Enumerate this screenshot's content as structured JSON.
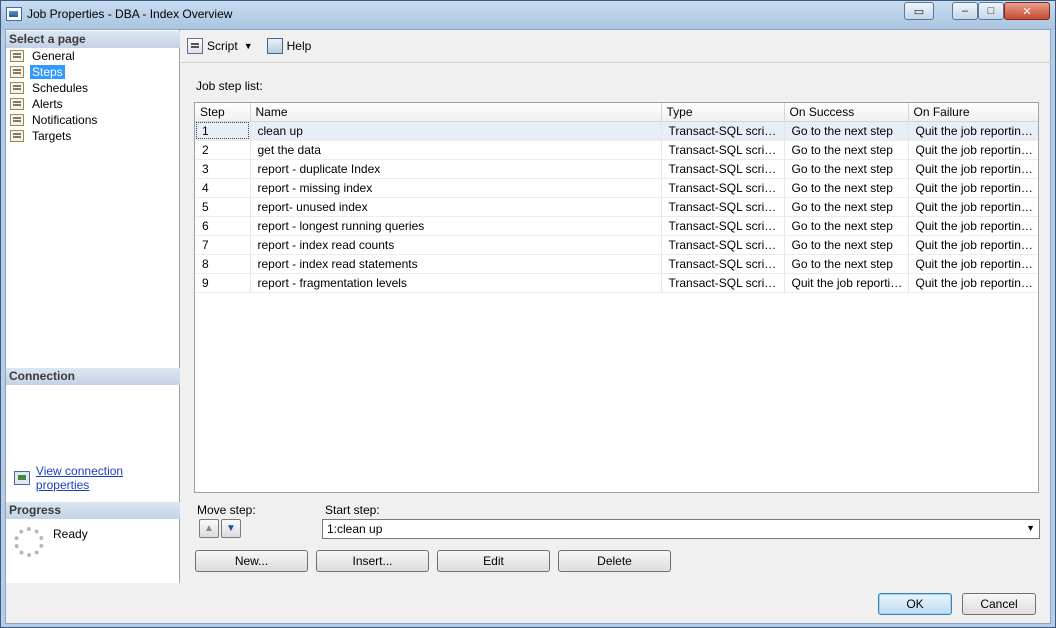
{
  "window": {
    "title": "Job Properties - DBA - Index Overview",
    "controls": {
      "minimize": "–",
      "maximize": "□",
      "close": "✕"
    }
  },
  "left_pane": {
    "select_page_header": "Select a page",
    "pages": [
      {
        "label": "General",
        "icon": "page-icon",
        "selected": false
      },
      {
        "label": "Steps",
        "icon": "page-icon",
        "selected": true
      },
      {
        "label": "Schedules",
        "icon": "page-icon",
        "selected": false
      },
      {
        "label": "Alerts",
        "icon": "page-icon",
        "selected": false
      },
      {
        "label": "Notifications",
        "icon": "page-icon",
        "selected": false
      },
      {
        "label": "Targets",
        "icon": "page-icon",
        "selected": false
      }
    ],
    "connection_header": "Connection",
    "view_connection_link": "View connection properties",
    "progress_header": "Progress",
    "progress_status": "Ready"
  },
  "toolbar": {
    "script_label": "Script",
    "help_label": "Help"
  },
  "main": {
    "job_step_list_label": "Job step list:",
    "columns": [
      "Step",
      "Name",
      "Type",
      "On Success",
      "On Failure"
    ],
    "rows": [
      [
        "1",
        "clean up",
        "Transact-SQL script (...",
        "Go to the next step",
        "Quit the job reporting f..."
      ],
      [
        "2",
        "get the data",
        "Transact-SQL script (...",
        "Go to the next step",
        "Quit the job reporting f..."
      ],
      [
        "3",
        "report - duplicate Index",
        "Transact-SQL script (...",
        "Go to the next step",
        "Quit the job reporting f..."
      ],
      [
        "4",
        "report - missing index",
        "Transact-SQL script (...",
        "Go to the next step",
        "Quit the job reporting f..."
      ],
      [
        "5",
        "report- unused index",
        "Transact-SQL script (...",
        "Go to the next step",
        "Quit the job reporting f..."
      ],
      [
        "6",
        "report  - longest running queries",
        "Transact-SQL script (...",
        "Go to the next step",
        "Quit the job reporting f..."
      ],
      [
        "7",
        "report - index read counts",
        "Transact-SQL script (...",
        "Go to the next step",
        "Quit the job reporting f..."
      ],
      [
        "8",
        "report - index read statements",
        "Transact-SQL script (...",
        "Go to the next step",
        "Quit the job reporting f..."
      ],
      [
        "9",
        "report - fragmentation levels",
        "Transact-SQL script (...",
        "Quit the job reporting...",
        "Quit the job reporting f..."
      ]
    ],
    "selected_row": 0,
    "move_step_label": "Move step:",
    "start_step_label": "Start step:",
    "start_step_value": "1:clean up",
    "buttons": {
      "new": "New...",
      "insert": "Insert...",
      "edit": "Edit",
      "delete": "Delete"
    }
  },
  "footer": {
    "ok": "OK",
    "cancel": "Cancel"
  }
}
